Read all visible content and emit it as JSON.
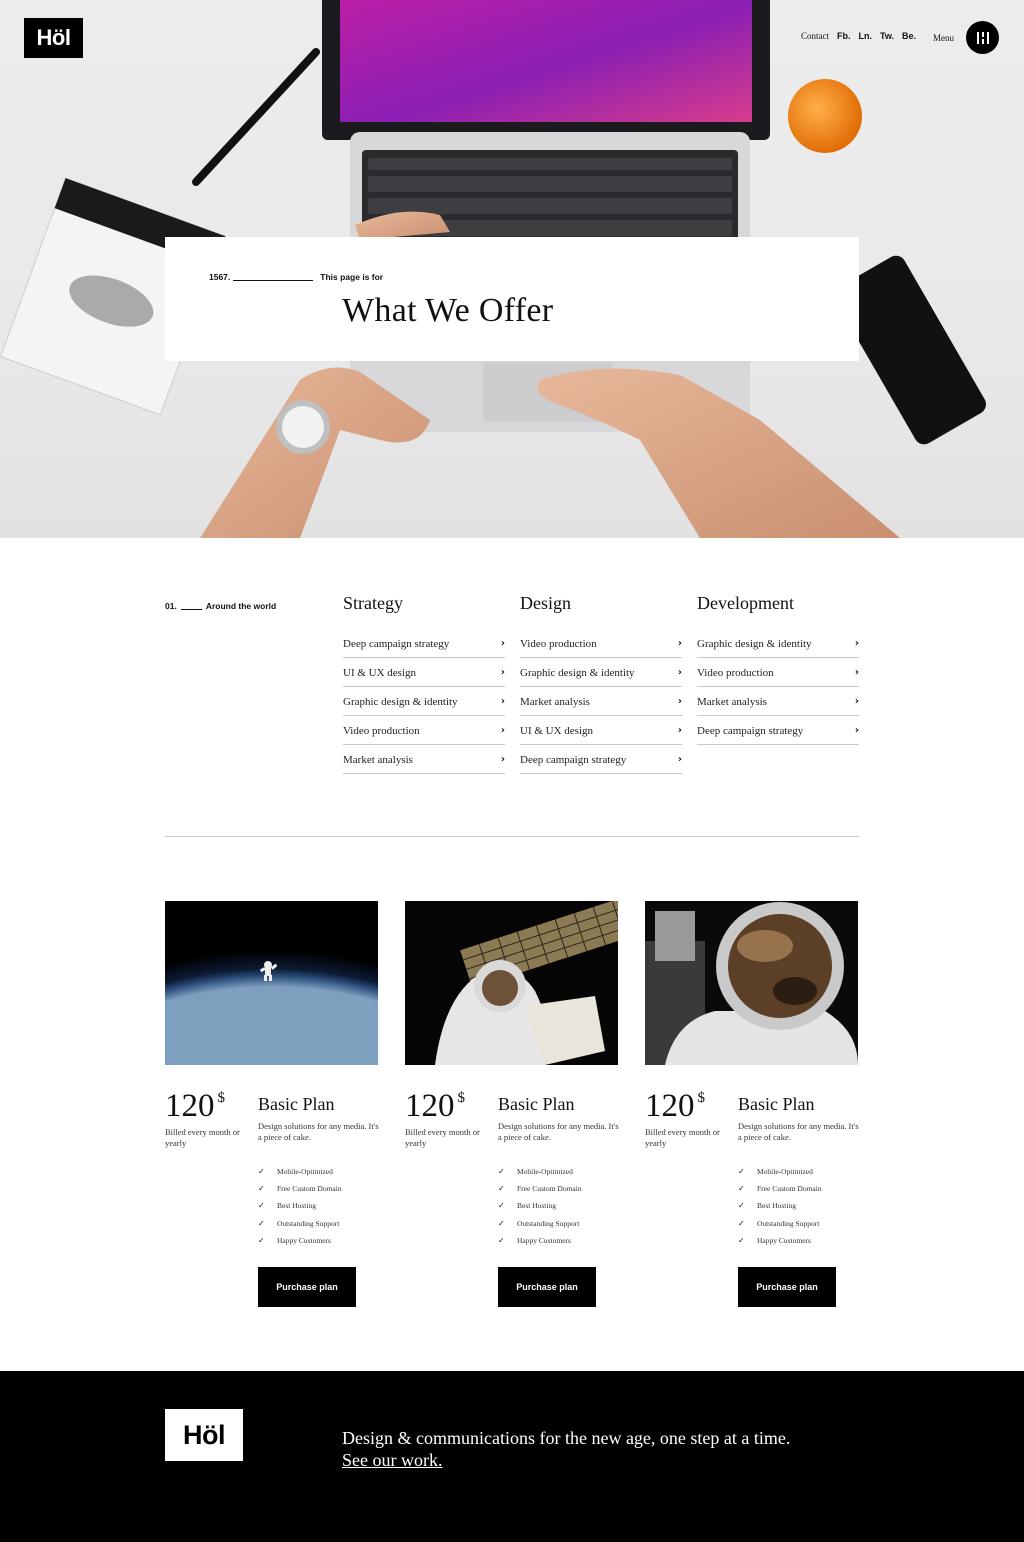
{
  "header": {
    "logo": "Höl",
    "contact": "Contact",
    "social": [
      "Fb.",
      "Ln.",
      "Tw.",
      "Be."
    ],
    "menu_label": "Menu"
  },
  "hero": {
    "number": "1567.",
    "eyebrow": "This page is for",
    "title": "What We Offer"
  },
  "services": {
    "number": "01.",
    "label": "Around the world",
    "columns": [
      {
        "title": "Strategy",
        "items": [
          "Deep campaign strategy",
          "UI & UX design",
          "Graphic design & identity",
          "Video production",
          "Market analysis"
        ]
      },
      {
        "title": "Design",
        "items": [
          "Video production",
          "Graphic design & identity",
          "Market analysis",
          "UI & UX design",
          "Deep campaign strategy"
        ]
      },
      {
        "title": "Development",
        "items": [
          "Graphic design & identity",
          "Video production",
          "Market analysis",
          "Deep campaign strategy"
        ]
      }
    ]
  },
  "pricing": {
    "plans": [
      {
        "price": "120",
        "currency": "$",
        "billed": "Billed every month or yearly",
        "name": "Basic Plan",
        "desc": "Design solutions for any media. It's a piece of cake.",
        "features": [
          "Mobile-Optimized",
          "Free Custom Domain",
          "Best Hosting",
          "Outstanding Support",
          "Happy Customers"
        ],
        "button": "Purchase plan"
      },
      {
        "price": "120",
        "currency": "$",
        "billed": "Billed every month or yearly",
        "name": "Basic Plan",
        "desc": "Design solutions for any media. It's a piece of cake.",
        "features": [
          "Mobile-Optimized",
          "Free Custom Domain",
          "Best Hosting",
          "Outstanding Support",
          "Happy Customers"
        ],
        "button": "Purchase plan"
      },
      {
        "price": "120",
        "currency": "$",
        "billed": "Billed every month or yearly",
        "name": "Basic Plan",
        "desc": "Design solutions for any media. It's a piece of cake.",
        "features": [
          "Mobile-Optimized",
          "Free Custom Domain",
          "Best Hosting",
          "Outstanding Support",
          "Happy Customers"
        ],
        "button": "Purchase plan"
      }
    ]
  },
  "footer": {
    "logo": "Höl",
    "tagline": "Design & communications for the new age, one step at a time.",
    "link": "See our work."
  },
  "icons": {
    "chevron": "chevron-right-icon",
    "check": "check-icon",
    "menu": "menu-icon"
  },
  "colors": {
    "black": "#000000",
    "white": "#ffffff",
    "divider": "#c9c9c9",
    "laptop_screen": "#9a1fb8"
  }
}
